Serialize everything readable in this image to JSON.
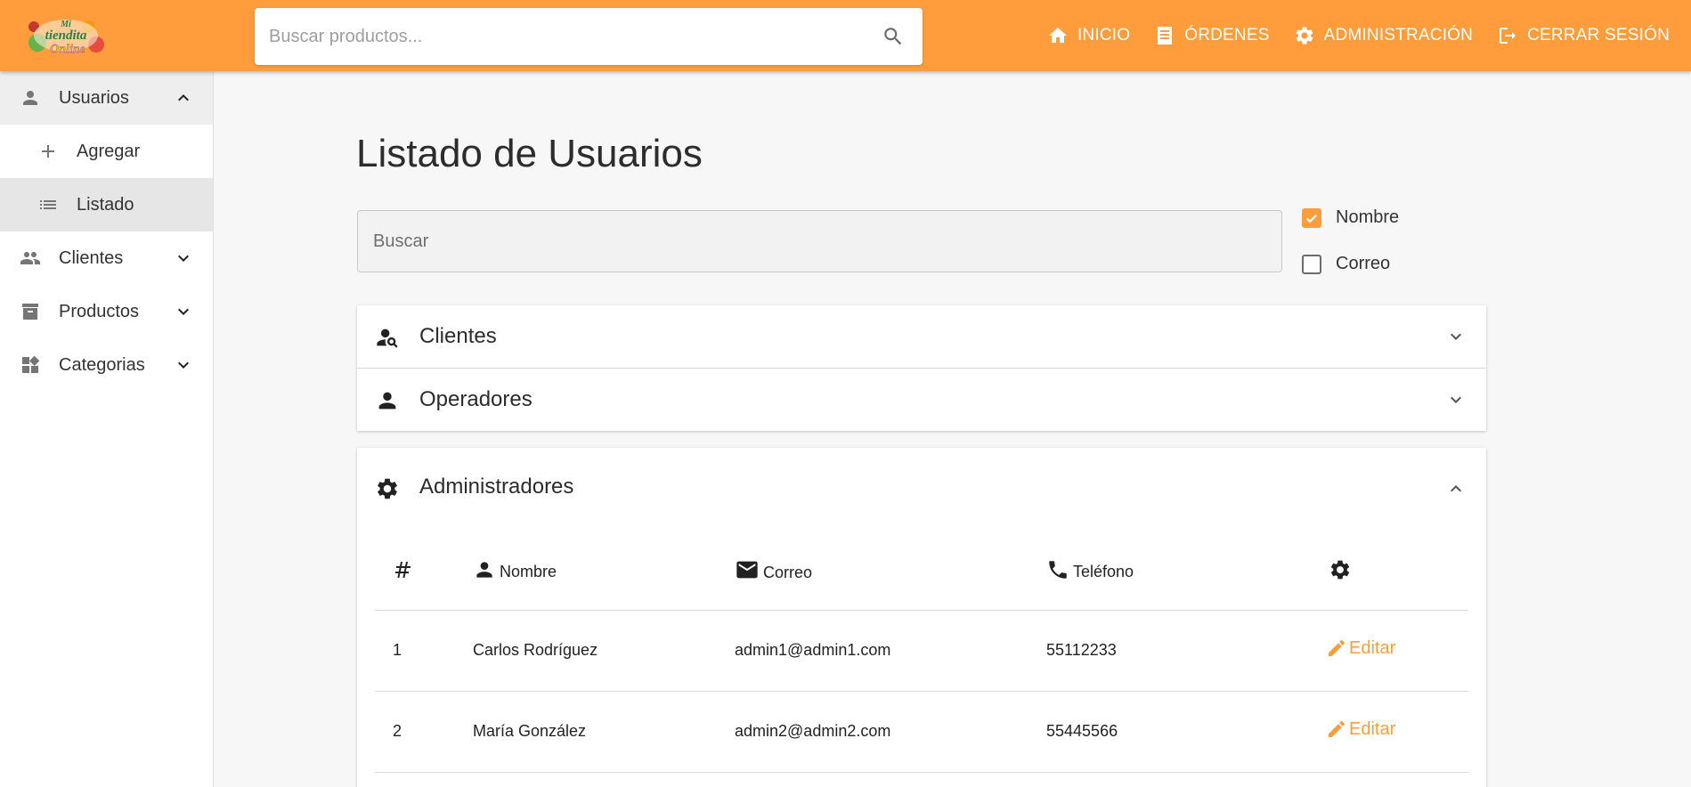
{
  "app": {
    "logo_text": "Mi tiendita Online",
    "colors": {
      "primary": "#ff9d3d",
      "sidebar_active": "#e6e6e6"
    }
  },
  "topbar": {
    "search_placeholder": "Buscar productos...",
    "nav": [
      {
        "label": "INICIO",
        "icon": "home-icon"
      },
      {
        "label": "ÓRDENES",
        "icon": "receipt-icon"
      },
      {
        "label": "ADMINISTRACIÓN",
        "icon": "gear-icon"
      },
      {
        "label": "CERRAR SESIÓN",
        "icon": "logout-icon"
      }
    ]
  },
  "sidebar": {
    "items": [
      {
        "label": "Usuarios",
        "icon": "person-icon",
        "expanded": true
      },
      {
        "label": "Clientes",
        "icon": "people-icon",
        "expanded": false
      },
      {
        "label": "Productos",
        "icon": "archive-icon",
        "expanded": false
      },
      {
        "label": "Categorias",
        "icon": "widgets-icon",
        "expanded": false
      }
    ],
    "subitems": [
      {
        "label": "Agregar",
        "icon": "plus-icon"
      },
      {
        "label": "Listado",
        "icon": "list-icon",
        "active": true
      }
    ]
  },
  "main": {
    "title": "Listado de Usuarios",
    "filter_placeholder": "Buscar",
    "checkboxes": [
      {
        "label": "Nombre",
        "checked": true
      },
      {
        "label": "Correo",
        "checked": false
      }
    ],
    "sections": [
      {
        "label": "Clientes",
        "icon": "person-search-icon",
        "expanded": false
      },
      {
        "label": "Operadores",
        "icon": "person-icon",
        "expanded": false
      },
      {
        "label": "Administradores",
        "icon": "gear-icon",
        "expanded": true
      }
    ],
    "table": {
      "headers": [
        "#",
        "Nombre",
        "Correo",
        "Teléfono"
      ],
      "rows": [
        {
          "id": "1",
          "name": "Carlos Rodríguez",
          "email": "admin1@admin1.com",
          "phone": "55112233",
          "action": "Editar"
        },
        {
          "id": "2",
          "name": "María González",
          "email": "admin2@admin2.com",
          "phone": "55445566",
          "action": "Editar"
        }
      ]
    }
  }
}
